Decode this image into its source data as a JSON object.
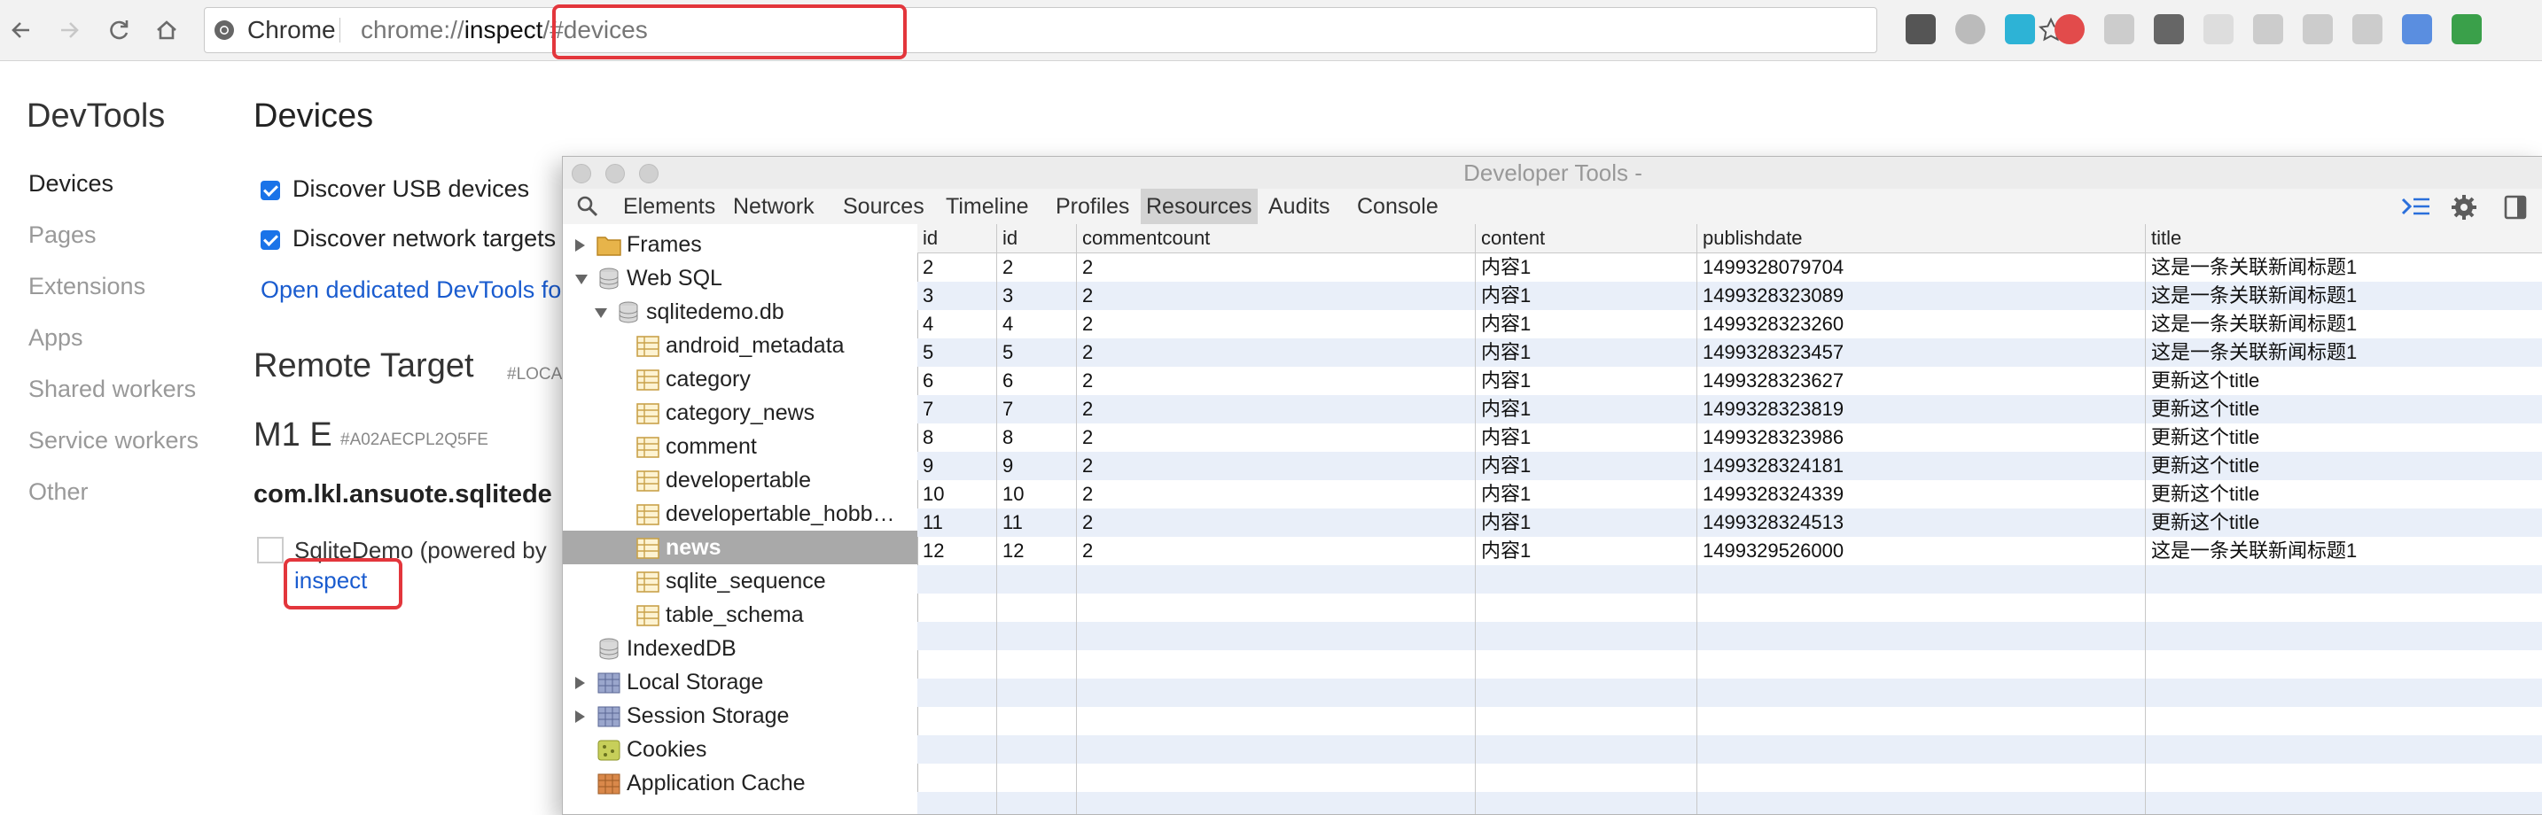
{
  "browser": {
    "site_chip": "Chrome",
    "url_prefix": "chrome://",
    "url_host": "inspect",
    "url_path": "/#devices",
    "extension_icons": [
      "evernote-icon",
      "fork-icon",
      "vue-devtools-icon",
      "pocket-red-icon",
      "adblock-shield-icon",
      "pocket-icon",
      "ar-icon",
      "zoom-icon",
      "printer-icon",
      "table-icon",
      "jh-icon",
      "tools-icon"
    ],
    "accent_highlight": "#e3363c"
  },
  "page_nav": {
    "heading": "DevTools",
    "items": [
      "Devices",
      "Pages",
      "Extensions",
      "Apps",
      "Shared workers",
      "Service workers",
      "Other"
    ],
    "active": "Devices"
  },
  "devices": {
    "heading": "Devices",
    "discover_usb": "Discover USB devices",
    "discover_network": "Discover network targets",
    "open_devtools_link": "Open dedicated DevTools fo",
    "remote_target": "Remote Target",
    "remote_target_sub": "#LOCA",
    "device_name": "M1 E",
    "device_id": "#A02AECPL2Q5FE",
    "package_name": "com.lkl.ansuote.sqlitede",
    "app_name": "SqliteDemo (powered by",
    "inspect_link": "inspect"
  },
  "devtools": {
    "title": "Developer Tools -",
    "tabs": [
      "Elements",
      "Network",
      "Sources",
      "Timeline",
      "Profiles",
      "Resources",
      "Audits",
      "Console"
    ],
    "active_tab": "Resources",
    "tree": [
      {
        "label": "Frames",
        "icon": "folder-icon",
        "indent": 0,
        "arrow": "right"
      },
      {
        "label": "Web SQL",
        "icon": "database-icon",
        "indent": 0,
        "arrow": "down"
      },
      {
        "label": "sqlitedemo.db",
        "icon": "database-icon",
        "indent": 1,
        "arrow": "down"
      },
      {
        "label": "android_metadata",
        "icon": "table-icon",
        "indent": 2,
        "arrow": ""
      },
      {
        "label": "category",
        "icon": "table-icon",
        "indent": 2,
        "arrow": ""
      },
      {
        "label": "category_news",
        "icon": "table-icon",
        "indent": 2,
        "arrow": ""
      },
      {
        "label": "comment",
        "icon": "table-icon",
        "indent": 2,
        "arrow": ""
      },
      {
        "label": "developertable",
        "icon": "table-icon",
        "indent": 2,
        "arrow": ""
      },
      {
        "label": "developertable_hobb…",
        "icon": "table-icon",
        "indent": 2,
        "arrow": ""
      },
      {
        "label": "news",
        "icon": "table-icon",
        "indent": 2,
        "arrow": "",
        "selected": true
      },
      {
        "label": "sqlite_sequence",
        "icon": "table-icon",
        "indent": 2,
        "arrow": ""
      },
      {
        "label": "table_schema",
        "icon": "table-icon",
        "indent": 2,
        "arrow": ""
      },
      {
        "label": "IndexedDB",
        "icon": "database-icon",
        "indent": 0,
        "arrow": ""
      },
      {
        "label": "Local Storage",
        "icon": "storage-grid-icon",
        "indent": 0,
        "arrow": "right"
      },
      {
        "label": "Session Storage",
        "icon": "storage-grid-icon",
        "indent": 0,
        "arrow": "right"
      },
      {
        "label": "Cookies",
        "icon": "cookie-icon",
        "indent": 0,
        "arrow": ""
      },
      {
        "label": "Application Cache",
        "icon": "app-cache-icon",
        "indent": 0,
        "arrow": ""
      }
    ],
    "columns": [
      "id",
      "id",
      "commentcount",
      "content",
      "publishdate",
      "title"
    ],
    "rows": [
      [
        "2",
        "2",
        "2",
        "内容1",
        "1499328079704",
        "这是一条关联新闻标题1"
      ],
      [
        "3",
        "3",
        "2",
        "内容1",
        "1499328323089",
        "这是一条关联新闻标题1"
      ],
      [
        "4",
        "4",
        "2",
        "内容1",
        "1499328323260",
        "这是一条关联新闻标题1"
      ],
      [
        "5",
        "5",
        "2",
        "内容1",
        "1499328323457",
        "这是一条关联新闻标题1"
      ],
      [
        "6",
        "6",
        "2",
        "内容1",
        "1499328323627",
        "更新这个title"
      ],
      [
        "7",
        "7",
        "2",
        "内容1",
        "1499328323819",
        "更新这个title"
      ],
      [
        "8",
        "8",
        "2",
        "内容1",
        "1499328323986",
        "更新这个title"
      ],
      [
        "9",
        "9",
        "2",
        "内容1",
        "1499328324181",
        "更新这个title"
      ],
      [
        "10",
        "10",
        "2",
        "内容1",
        "1499328324339",
        "更新这个title"
      ],
      [
        "11",
        "11",
        "2",
        "内容1",
        "1499328324513",
        "更新这个title"
      ],
      [
        "12",
        "12",
        "2",
        "内容1",
        "1499329526000",
        "这是一条关联新闻标题1"
      ]
    ]
  }
}
